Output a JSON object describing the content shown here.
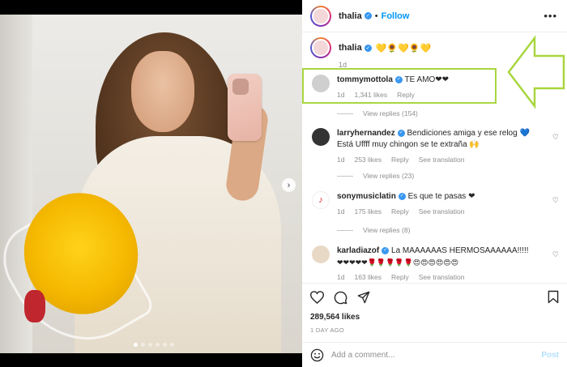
{
  "post": {
    "username": "thalia",
    "follow_label": "Follow",
    "more_label": "•••",
    "caption": {
      "username": "thalia",
      "emojis": "💛🌻💛🌻💛",
      "time": "1d"
    },
    "carousel": {
      "slides": 6,
      "active_index": 0
    }
  },
  "comments": [
    {
      "username": "tommymottola",
      "text": "TE AMO❤❤",
      "time": "1d",
      "likes": "1,341 likes",
      "reply": "Reply",
      "view_replies": "View replies (154)",
      "highlighted": true
    },
    {
      "username": "larryhernandez",
      "text": "Bendiciones amiga y ese relog 💙 Está Uffff muy chingon se te extraña 🙌",
      "time": "1d",
      "likes": "253 likes",
      "reply": "Reply",
      "translation": "See translation",
      "view_replies": "View replies (23)"
    },
    {
      "username": "sonymusiclatin",
      "text": "Es que te pasas ❤",
      "time": "1d",
      "likes": "175 likes",
      "reply": "Reply",
      "translation": "See translation",
      "view_replies": "View replies (8)"
    },
    {
      "username": "karladiazof",
      "text": "La MAAAAAAS HERMOSAAAAAA!!!!!",
      "emojis": "❤❤❤❤❤🌹🌹🌹🌹🌹😍😍😍😍😍😍",
      "time": "1d",
      "likes": "163 likes",
      "reply": "Reply",
      "translation": "See translation"
    }
  ],
  "footer": {
    "likes": "289,564 likes",
    "date": "1 DAY AGO",
    "add_comment_placeholder": "Add a comment...",
    "post_label": "Post"
  },
  "colors": {
    "follow": "#0095f6",
    "highlight": "#a9d63f",
    "verified": "#3897f0"
  },
  "icons": [
    "heart-icon",
    "comment-icon",
    "share-icon",
    "bookmark-icon",
    "smiley-icon",
    "verified-icon",
    "chevron-right-icon",
    "more-icon",
    "arrow-left-icon"
  ]
}
